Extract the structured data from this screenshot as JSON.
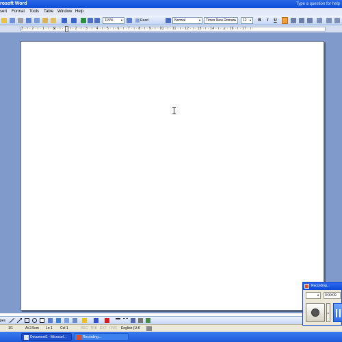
{
  "window": {
    "title": "rosoft Word",
    "right_label": "Type a question for help"
  },
  "menubar": {
    "items": [
      "sert",
      "Format",
      "Tools",
      "Table",
      "Window",
      "Help"
    ]
  },
  "toolbar": {
    "zoom": "115%",
    "read_label": "Read",
    "style": "Normal",
    "font": "Times New Roman",
    "size": "12",
    "bold": "B",
    "italic": "I",
    "underline": "U"
  },
  "ruler": {
    "numbers": "3 · ı · 2 · ı · 1 · ı · ⊠ · ı · 1 · ı · 2 · ı · 3 · ı · 4 · ı · 5 · ı · 6 · ı · 7 · ı · 8 · ı · 9 · ı · 10 · ı · 11 · ı · 12 · ı · 13 · ı · 14 · ı · ⊿ · 16 · ı · 17 · ı ·"
  },
  "drawbar": {
    "label": "pes"
  },
  "statusbar": {
    "page": "1/1",
    "at": "At 2.5cm",
    "line": "Ln 1",
    "col": "Col 1",
    "rec": "REC",
    "trk": "TRK",
    "ext": "EXT",
    "ovr": "OVR",
    "language": "English (U.K"
  },
  "taskbar": {
    "document_task": "Document1 - Microsof...",
    "recording_task": "Recording..."
  },
  "recording_window": {
    "title": "Recording...",
    "timer": "0:00:09"
  },
  "colors": {
    "title_blue": "#0b4cd8",
    "workspace": "#7f9acb",
    "active_button": "#f3a03c"
  }
}
